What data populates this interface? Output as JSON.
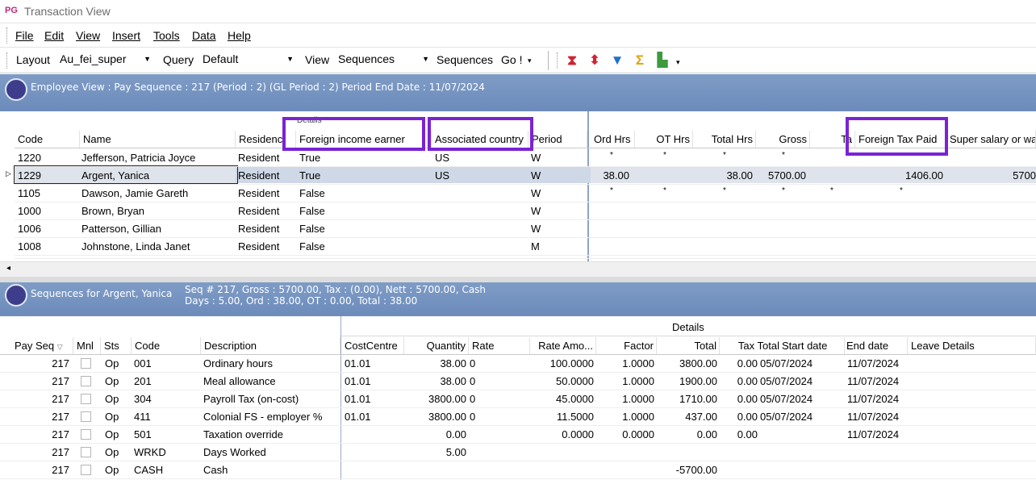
{
  "window": {
    "logo": "PG",
    "title": "Transaction View"
  },
  "menu": [
    "File",
    "Edit",
    "View",
    "Insert",
    "Tools",
    "Data",
    "Help"
  ],
  "toolbar": {
    "layout_label": "Layout",
    "layout_value": "Au_fei_super",
    "query_label": "Query",
    "query_value": "Default",
    "view_label": "View",
    "view_value": "Sequences",
    "sequences_label": "Sequences",
    "go_label": "Go !"
  },
  "employee_band": {
    "text": "Employee View : Pay Sequence : 217 (Period : 2) (GL Period : 2) Period End Date : 11/07/2024"
  },
  "employee_grid": {
    "group_label": "Details",
    "left_headers": [
      "Code",
      "Name",
      "Residenc",
      "Foreign income earner",
      "Associated country",
      "Period"
    ],
    "right_headers": [
      "Ord Hrs",
      "OT Hrs",
      "Total Hrs",
      "Gross",
      "Ta",
      "Foreign Tax Paid",
      "Super salary or wa"
    ],
    "rows": [
      {
        "code": "1220",
        "name": "Jefferson, Patricia Joyce",
        "res": "Resident",
        "fie": "True",
        "country": "US",
        "period": "W",
        "ord": "*",
        "ot": "*",
        "total": "*",
        "gross": "*",
        "tax": "",
        "ftp": "",
        "super": ""
      },
      {
        "code": "1229",
        "name": "Argent, Yanica",
        "res": "Resident",
        "fie": "True",
        "country": "US",
        "period": "W",
        "ord": "38.00",
        "ot": "",
        "total": "38.00",
        "gross": "5700.00",
        "tax": "",
        "ftp": "1406.00",
        "super": "5700"
      },
      {
        "code": "1105",
        "name": "Dawson, Jamie Gareth",
        "res": "Resident",
        "fie": "False",
        "country": "",
        "period": "W",
        "ord": "*",
        "ot": "*",
        "total": "*",
        "gross": "*",
        "tax": "*",
        "ftp": "*",
        "super": ""
      },
      {
        "code": "1000",
        "name": "Brown, Bryan",
        "res": "Resident",
        "fie": "False",
        "country": "",
        "period": "W",
        "ord": "",
        "ot": "",
        "total": "",
        "gross": "",
        "tax": "",
        "ftp": "",
        "super": ""
      },
      {
        "code": "1006",
        "name": "Patterson, Gillian",
        "res": "Resident",
        "fie": "False",
        "country": "",
        "period": "W",
        "ord": "",
        "ot": "",
        "total": "",
        "gross": "",
        "tax": "",
        "ftp": "",
        "super": ""
      },
      {
        "code": "1008",
        "name": "Johnstone, Linda Janet",
        "res": "Resident",
        "fie": "False",
        "country": "",
        "period": "M",
        "ord": "",
        "ot": "",
        "total": "",
        "gross": "",
        "tax": "",
        "ftp": "",
        "super": ""
      }
    ]
  },
  "sequence_band": {
    "title": "Sequences  for Argent, Yanica",
    "line1": "Seq # 217, Gross : 5700.00, Tax : (0.00), Nett : 5700.00, Cash",
    "line2": "Days : 5.00, Ord : 38.00, OT : 0.00, Total : 38.00"
  },
  "sequence_grid": {
    "group_label": "Details",
    "headers": [
      "Pay Seq",
      "Mnl",
      "Sts",
      "Code",
      "Description",
      "CostCentre",
      "Quantity",
      "Rate",
      "Rate Amo...",
      "Factor",
      "Total",
      "Tax Total",
      "Start date",
      "End date",
      "Leave Details"
    ],
    "rows": [
      {
        "seq": "217",
        "sts": "Op",
        "code": "001",
        "desc": "Ordinary hours",
        "cc": "01.01",
        "qty": "38.00",
        "rate": "0",
        "amt": "100.0000",
        "factor": "1.0000",
        "total": "3800.00",
        "tax": "0.00",
        "start": "05/07/2024",
        "end": "11/07/2024"
      },
      {
        "seq": "217",
        "sts": "Op",
        "code": "201",
        "desc": "Meal allowance",
        "cc": "01.01",
        "qty": "38.00",
        "rate": "0",
        "amt": "50.0000",
        "factor": "1.0000",
        "total": "1900.00",
        "tax": "0.00",
        "start": "05/07/2024",
        "end": "11/07/2024"
      },
      {
        "seq": "217",
        "sts": "Op",
        "code": "304",
        "desc": "Payroll Tax (on-cost)",
        "cc": "01.01",
        "qty": "3800.00",
        "rate": "0",
        "amt": "45.0000",
        "factor": "1.0000",
        "total": "1710.00",
        "tax": "0.00",
        "start": "05/07/2024",
        "end": "11/07/2024"
      },
      {
        "seq": "217",
        "sts": "Op",
        "code": "411",
        "desc": "Colonial FS - employer %",
        "cc": "01.01",
        "qty": "3800.00",
        "rate": "0",
        "amt": "11.5000",
        "factor": "1.0000",
        "total": "437.00",
        "tax": "0.00",
        "start": "05/07/2024",
        "end": "11/07/2024"
      },
      {
        "seq": "217",
        "sts": "Op",
        "code": "501",
        "desc": "Taxation override",
        "cc": "",
        "qty": "0.00",
        "rate": "",
        "amt": "0.0000",
        "factor": "0.0000",
        "total": "0.00",
        "tax": "0.00",
        "start": "",
        "end": "11/07/2024"
      },
      {
        "seq": "217",
        "sts": "Op",
        "code": "WRKD",
        "desc": "Days Worked",
        "cc": "",
        "qty": "5.00",
        "rate": "",
        "amt": "",
        "factor": "",
        "total": "",
        "tax": "",
        "start": "",
        "end": ""
      },
      {
        "seq": "217",
        "sts": "Op",
        "code": "CASH",
        "desc": "Cash",
        "cc": "",
        "qty": "",
        "rate": "",
        "amt": "",
        "factor": "",
        "total": "-5700.00",
        "tax": "",
        "start": "",
        "end": ""
      }
    ]
  }
}
